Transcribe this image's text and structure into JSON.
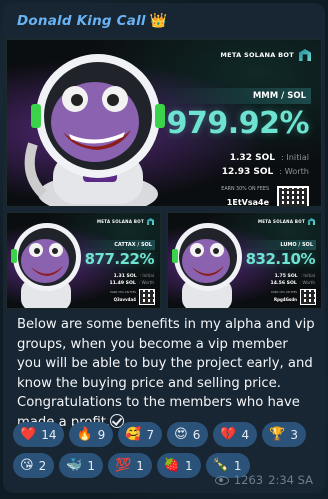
{
  "channel": {
    "sender": "Donald King Call",
    "sender_emoji": "👑"
  },
  "media": {
    "main": {
      "brand": "META SOLANA BOT",
      "pair": "MMM / SOL",
      "percent": "979.92%",
      "initial_value": "1.32 SOL",
      "initial_label": ": Initial",
      "worth_value": "12.93 SOL",
      "worth_label": ": Worth",
      "earn_text": "EARN 30% ON FEES",
      "ref_code": "1EtVsa4e"
    },
    "card2": {
      "brand": "META SOLANA BOT",
      "pair": "CATTAX / SOL",
      "percent": "877.22%",
      "initial_value": "1.31 SOL",
      "initial_label": ": Initial",
      "worth_value": "11.49 SOL",
      "worth_label": ": Worth",
      "earn_text": "EARN 30% ON FEES",
      "ref_code": "Q3avv4a4"
    },
    "card3": {
      "brand": "META SOLANA BOT",
      "pair": "LUMO / SOL",
      "percent": "832.10%",
      "initial_value": "1.75 SOL",
      "initial_label": ": Initial",
      "worth_value": "14.56 SOL",
      "worth_label": ": Worth",
      "earn_text": "EARN 30% ON FEES",
      "ref_code": "Rpg4Gsdn"
    }
  },
  "message": {
    "text": "Below are some benefits in my alpha and vip groups, when you become a vip member you will be able to buy the project early, and know the buying price and selling price. Congratulations to the members who have made a profit."
  },
  "reactions": [
    {
      "emoji": "❤️",
      "count": "14"
    },
    {
      "emoji": "🔥",
      "count": "9"
    },
    {
      "emoji": "🥰",
      "count": "7"
    },
    {
      "emoji": "😍",
      "count": "6"
    },
    {
      "emoji": "💔",
      "count": "4"
    },
    {
      "emoji": "🏆",
      "count": "3"
    },
    {
      "emoji": "😘",
      "count": "2"
    },
    {
      "emoji": "🐳",
      "count": "1"
    },
    {
      "emoji": "💯",
      "count": "1"
    },
    {
      "emoji": "🍓",
      "count": "1"
    },
    {
      "emoji": "🍾",
      "count": "1"
    }
  ],
  "footer": {
    "views": "1263",
    "time": "2:34 SA"
  },
  "colors": {
    "bubble": "#182533",
    "sender": "#6ab3f3",
    "accent_teal": "#6fe3d1",
    "reaction_bg": "#2b5278"
  }
}
